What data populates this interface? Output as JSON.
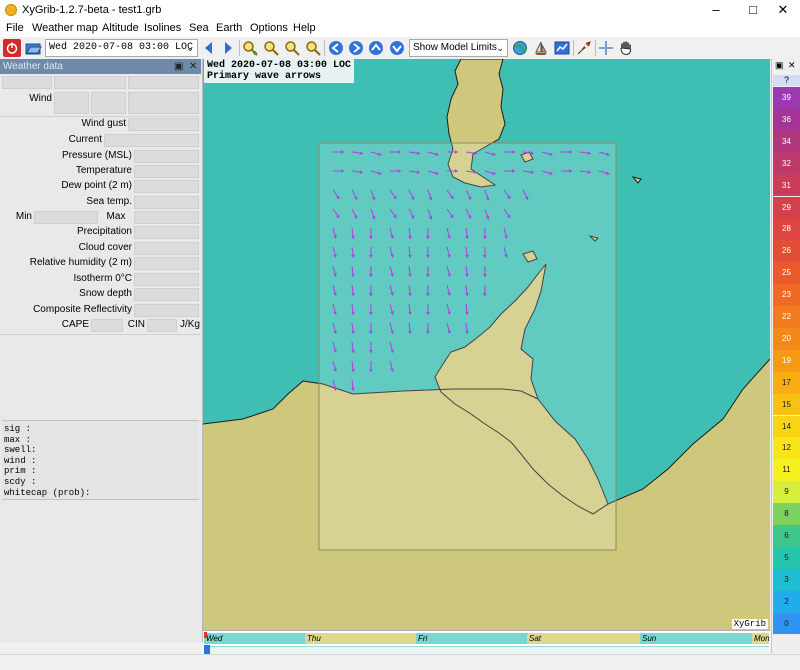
{
  "window": {
    "title": "XyGrib-1.2.7-beta - test1.grb"
  },
  "menubar": {
    "items": [
      "File",
      "Weather map",
      "Altitude",
      "Isolines",
      "Sea",
      "Earth",
      "Options",
      "Help"
    ]
  },
  "toolbar": {
    "date_value": "Wed 2020-07-08 03:00 LOC",
    "model_limits_value": "Show Model Limits"
  },
  "panel": {
    "title": "Weather data",
    "rows": {
      "wind": "Wind",
      "wind_gust": "Wind gust",
      "current": "Current",
      "pressure": "Pressure (MSL)",
      "temperature": "Temperature",
      "dew_point": "Dew point (2 m)",
      "sea_temp": "Sea temp.",
      "min": "Min",
      "max": "Max",
      "precipitation": "Precipitation",
      "cloud_cover": "Cloud cover",
      "humidity": "Relative humidity (2 m)",
      "isotherm": "Isotherm 0°C",
      "snow_depth": "Snow depth",
      "reflectivity": "Composite Reflectivity",
      "cape": "CAPE",
      "cin": "CIN",
      "cin_unit": "J/Kg"
    },
    "wave_lines": [
      "sig  :",
      "max  :",
      "swell:",
      "wind :",
      "prim :",
      "scdy :",
      "whitecap (prob):"
    ]
  },
  "map": {
    "date_label": "Wed 2020-07-08 03:00 LOC",
    "layer_label": "Primary wave arrows",
    "logo": "XyGrib",
    "sea_color": "#3fbfb4",
    "land_color": "#cec87c",
    "arrow_color": "#b43ce6"
  },
  "timeline": {
    "days": [
      "Wed",
      "Thu",
      "Fri",
      "Sat",
      "Sun",
      "Mon"
    ],
    "position": 0.0
  },
  "legend": {
    "head": "?",
    "entries": [
      {
        "label": "39",
        "color": "#9a39b0"
      },
      {
        "label": "36",
        "color": "#a43596"
      },
      {
        "label": "34",
        "color": "#b2367c"
      },
      {
        "label": "32",
        "color": "#bd3a69"
      },
      {
        "label": "31",
        "color": "#c93d58"
      },
      {
        "label": "29",
        "color": "#d4414b"
      },
      {
        "label": "28",
        "color": "#dd4640"
      },
      {
        "label": "26",
        "color": "#e24e35"
      },
      {
        "label": "25",
        "color": "#e85a2c"
      },
      {
        "label": "23",
        "color": "#ee6a25"
      },
      {
        "label": "22",
        "color": "#f27a1f"
      },
      {
        "label": "20",
        "color": "#f4891a"
      },
      {
        "label": "19",
        "color": "#f69a16"
      },
      {
        "label": "17",
        "color": "#f8ad14"
      },
      {
        "label": "15",
        "color": "#f9c114"
      },
      {
        "label": "14",
        "color": "#f9d416"
      },
      {
        "label": "12",
        "color": "#f8e51a"
      },
      {
        "label": "11",
        "color": "#f4f11e"
      },
      {
        "label": "9",
        "color": "#d6ee3c"
      },
      {
        "label": "8",
        "color": "#7bd25f"
      },
      {
        "label": "6",
        "color": "#3dc78a"
      },
      {
        "label": "5",
        "color": "#25c4ad"
      },
      {
        "label": "3",
        "color": "#1fbdd0"
      },
      {
        "label": "2",
        "color": "#23acec"
      },
      {
        "label": "0",
        "color": "#2f94f4"
      }
    ]
  }
}
